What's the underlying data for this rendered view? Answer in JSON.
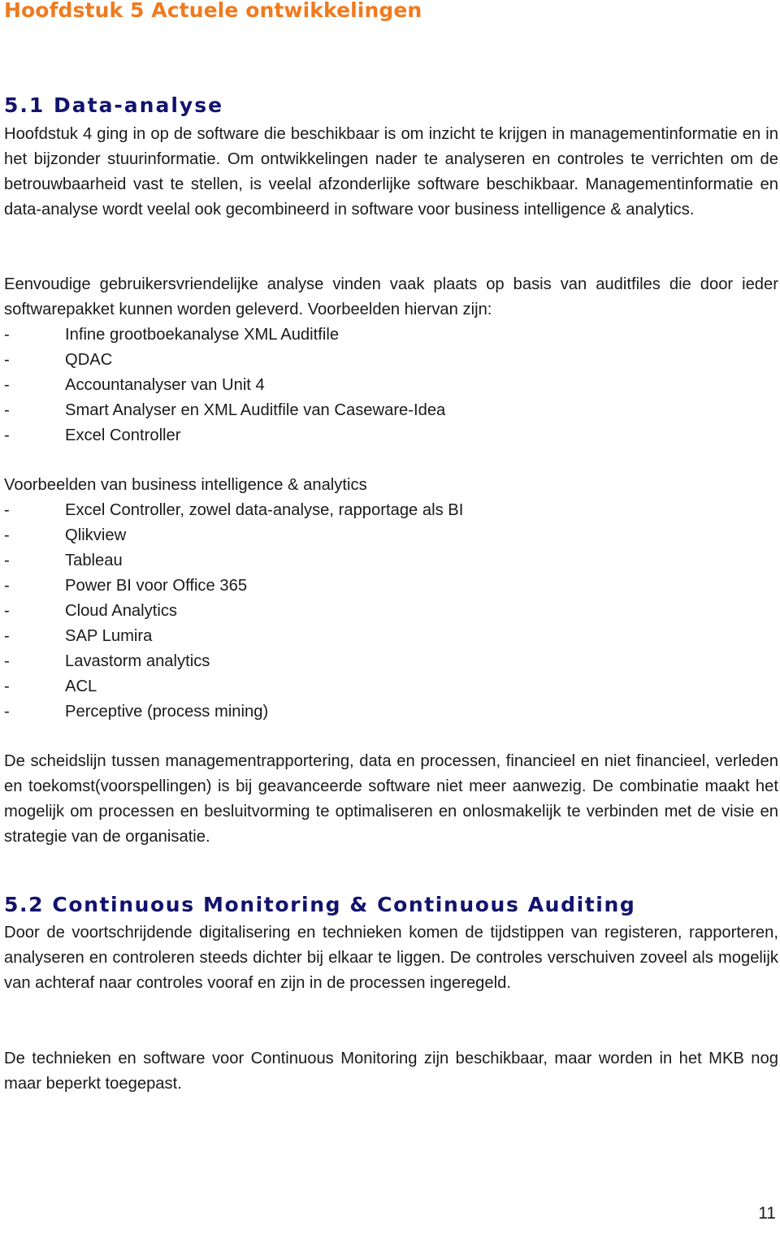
{
  "chapter_title": "Hoofdstuk 5 Actuele ontwikkelingen",
  "section_1": {
    "heading": "5.1 Data-analyse",
    "paragraph_1": "Hoofdstuk 4 ging in op de software die beschikbaar is om inzicht te krijgen in managementinformatie en in het bijzonder stuurinformatie. Om ontwikkelingen nader te analyseren en controles te verrichten om de betrouwbaarheid vast te stellen, is veelal afzonderlijke software beschikbaar. Managementinformatie en data-analyse wordt veelal ook gecombineerd in software voor business intelligence & analytics.",
    "paragraph_2": "Eenvoudige gebruikersvriendelijke analyse vinden vaak plaats op basis van auditfiles die door ieder softwarepakket kunnen worden geleverd. Voorbeelden hiervan zijn:",
    "list_1": [
      "Infine grootboekanalyse XML Auditfile",
      "QDAC",
      "Accountanalyser van Unit 4",
      "Smart Analyser en XML Auditfile van Caseware-Idea",
      "Excel Controller"
    ],
    "paragraph_3": "Voorbeelden van business intelligence & analytics",
    "list_2": [
      "Excel Controller, zowel data-analyse, rapportage als BI",
      "Qlikview",
      "Tableau",
      "Power BI voor Office 365",
      "Cloud Analytics",
      "SAP Lumira",
      "Lavastorm analytics",
      "ACL",
      "Perceptive (process mining)"
    ],
    "paragraph_4": "De scheidslijn tussen managementrapportering, data en processen, financieel en niet financieel, verleden en toekomst(voorspellingen) is bij geavanceerde software niet meer aanwezig. De combinatie maakt het mogelijk om processen en besluitvorming te optimaliseren en onlosmakelijk te verbinden met de visie en strategie van de organisatie."
  },
  "section_2": {
    "heading": "5.2 Continuous Monitoring & Continuous Auditing",
    "paragraph_1": "Door de voortschrijdende digitalisering en technieken komen de tijdstippen van registeren, rapporteren, analyseren en controleren steeds dichter bij elkaar te liggen. De controles verschuiven zoveel als mogelijk van achteraf naar controles vooraf en zijn in de processen ingeregeld.",
    "paragraph_2": "De technieken en software voor Continuous Monitoring zijn beschikbaar, maar worden in het MKB nog maar beperkt toegepast."
  },
  "list_marker": "-",
  "page_number": "11",
  "colors": {
    "chapter_heading": "#f07a1e",
    "section_heading": "#12126e",
    "body_text": "#1a1a1a"
  }
}
